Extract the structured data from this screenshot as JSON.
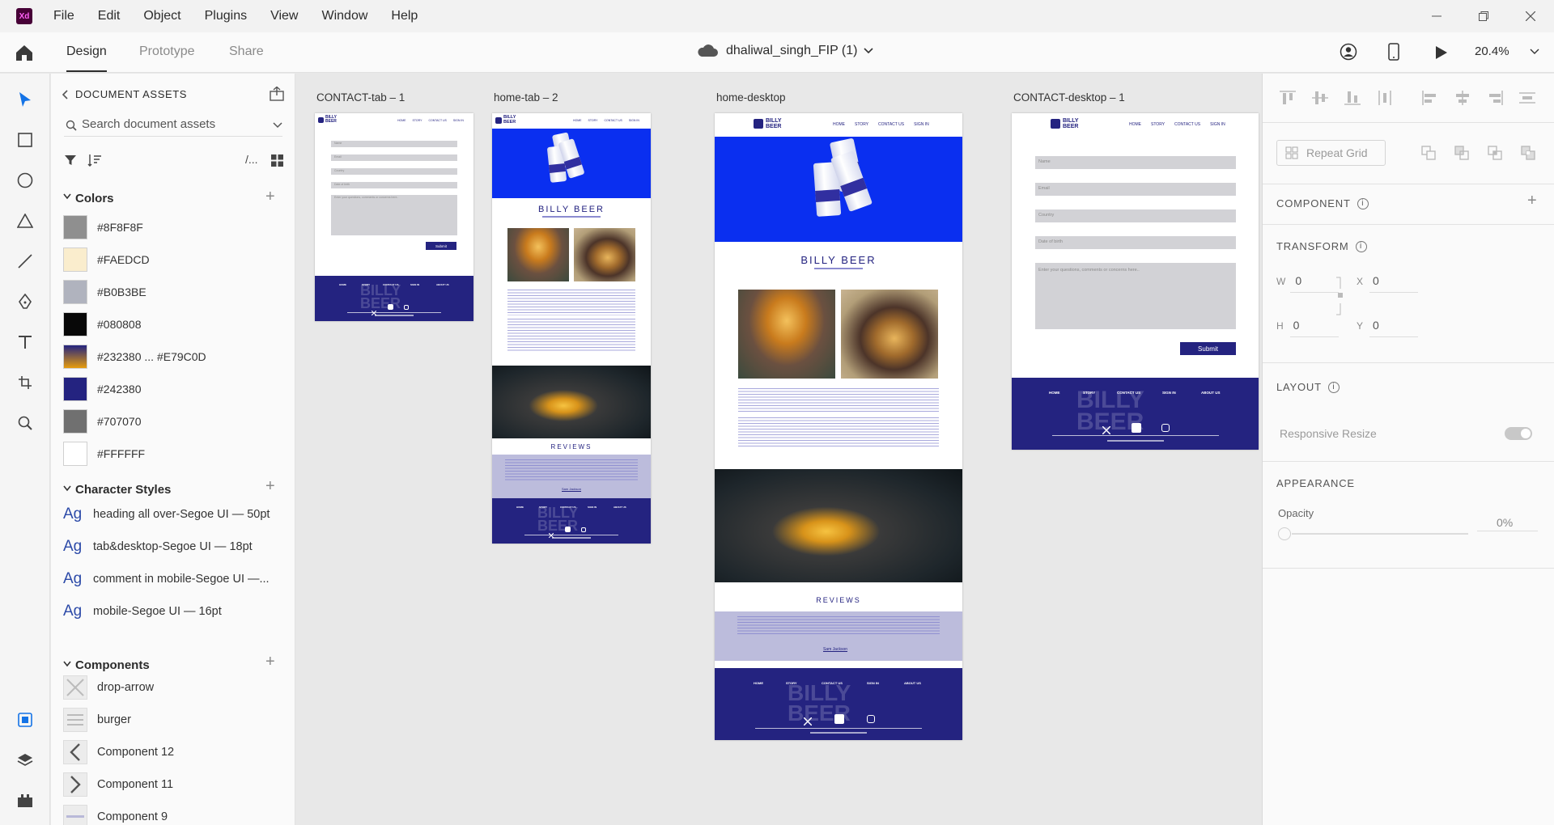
{
  "menubar": {
    "app_logo": "Xd",
    "items": [
      "File",
      "Edit",
      "Object",
      "Plugins",
      "View",
      "Window",
      "Help"
    ]
  },
  "toolbar": {
    "tabs": [
      "Design",
      "Prototype",
      "Share"
    ],
    "active_tab": "Design",
    "doc_title": "dhaliwal_singh_FIP (1)",
    "zoom": "20.4%"
  },
  "assets": {
    "header": "DOCUMENT ASSETS",
    "search_placeholder": "Search document assets",
    "filter_label": "/...",
    "colors_title": "Colors",
    "colors": [
      {
        "label": "#8F8F8F",
        "hex": "#8F8F8F"
      },
      {
        "label": "#FAEDCD",
        "hex": "#FAEDCD"
      },
      {
        "label": "#B0B3BE",
        "hex": "#B0B3BE"
      },
      {
        "label": "#080808",
        "hex": "#080808"
      },
      {
        "label": "#232380 ... #E79C0D",
        "hex": "linear-gradient(180deg,#232380,#E79C0D)"
      },
      {
        "label": "#242380",
        "hex": "#242380"
      },
      {
        "label": "#707070",
        "hex": "#707070"
      },
      {
        "label": "#FFFFFF",
        "hex": "#FFFFFF"
      }
    ],
    "char_styles_title": "Character Styles",
    "char_styles": [
      "heading all over-Segoe UI — 50pt",
      "tab&desktop-Segoe UI — 18pt",
      "comment in mobile-Segoe UI —...",
      "mobile-Segoe UI — 16pt"
    ],
    "char_style_glyph": "Ag",
    "components_title": "Components",
    "components": [
      "drop-arrow",
      "burger",
      "Component 12",
      "Component 11",
      "Component 9"
    ]
  },
  "canvas": {
    "artboards": [
      {
        "label": "CONTACT-tab – 1"
      },
      {
        "label": "home-tab – 2"
      },
      {
        "label": "home-desktop"
      },
      {
        "label": "CONTACT-desktop – 1"
      }
    ],
    "site": {
      "logo_top": "BILLY",
      "logo_bottom": "BEER",
      "nav": [
        "HOME",
        "STORY",
        "CONTACT US",
        "SIGN IN"
      ],
      "footer_links": [
        "HOME",
        "STORY",
        "CONTACT US",
        "SIGN IN",
        "ABOUT US"
      ],
      "footer_watermark_top": "BILLY",
      "footer_watermark_bottom": "BEER",
      "hero_title": "BILLY BEER",
      "reviews_title": "REVIEWS",
      "reviewer": "Sam Jackson",
      "form_fields": [
        "Name",
        "Email",
        "Country",
        "Date of birth"
      ],
      "form_message": "Enter your questions, comments or concerns here..",
      "submit": "Submit"
    }
  },
  "props": {
    "repeat_grid": "Repeat Grid",
    "component": "COMPONENT",
    "transform": "TRANSFORM",
    "w_label": "W",
    "w_value": "0",
    "x_label": "X",
    "x_value": "0",
    "h_label": "H",
    "h_value": "0",
    "y_label": "Y",
    "y_value": "0",
    "layout": "LAYOUT",
    "responsive_resize": "Responsive Resize",
    "appearance": "APPEARANCE",
    "opacity_label": "Opacity",
    "opacity_value": "0%"
  }
}
